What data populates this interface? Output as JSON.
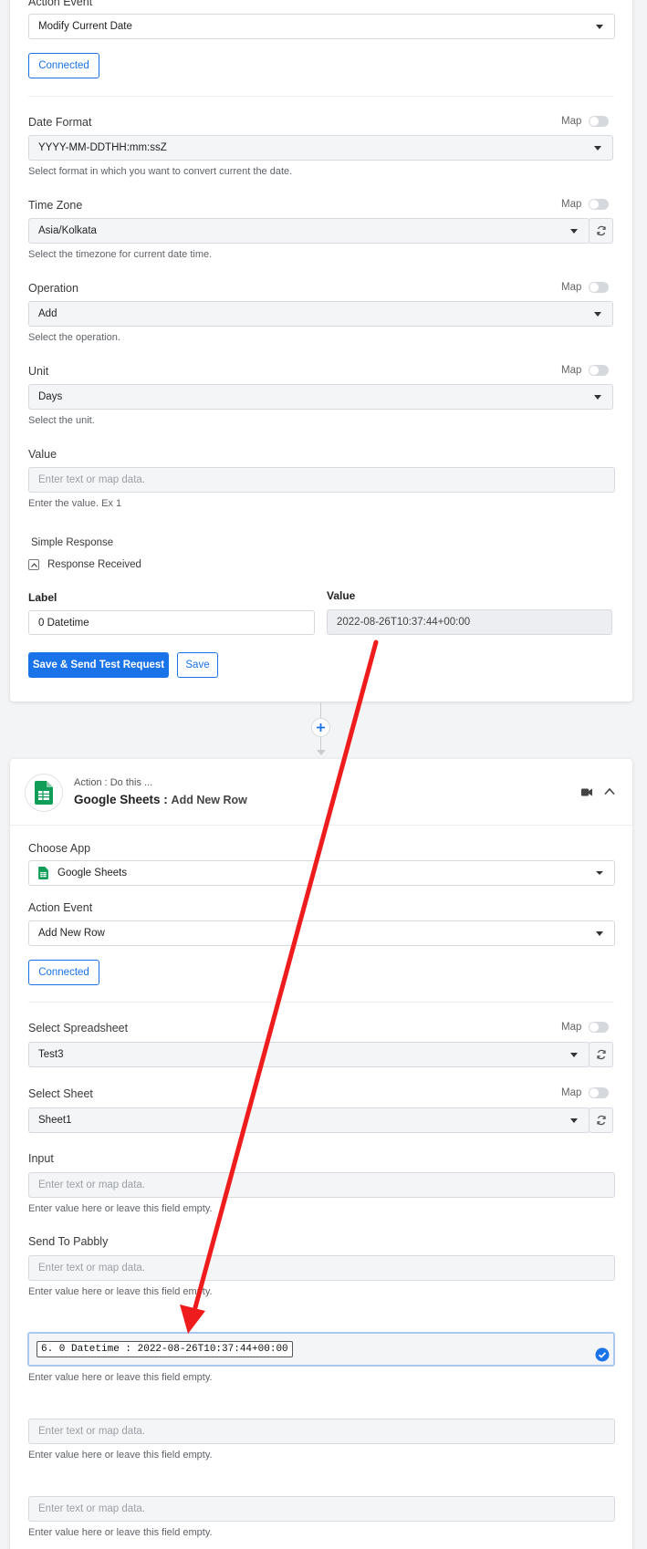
{
  "step1": {
    "action_event_label": "Action Event",
    "action_event_value": "Modify Current Date",
    "connected_label": "Connected",
    "map_label": "Map",
    "date_format": {
      "label": "Date Format",
      "value": "YYYY-MM-DDTHH:mm:ssZ",
      "help": "Select format in which you want to convert current the date."
    },
    "time_zone": {
      "label": "Time Zone",
      "value": "Asia/Kolkata",
      "help": "Select the timezone for current date time."
    },
    "operation": {
      "label": "Operation",
      "value": "Add",
      "help": "Select the operation."
    },
    "unit": {
      "label": "Unit",
      "value": "Days",
      "help": "Select the unit."
    },
    "value_field": {
      "label": "Value",
      "placeholder": "Enter text or map data.",
      "help": "Enter the value. Ex 1"
    },
    "simple_response_label": "Simple Response",
    "response_received_label": "Response Received",
    "response_table": {
      "label_header": "Label",
      "value_header": "Value",
      "row_label": "0 Datetime",
      "row_value": "2022-08-26T10:37:44+00:00"
    },
    "save_send_label": "Save & Send Test Request",
    "save_label": "Save"
  },
  "step2": {
    "header_small": "Action : Do this ...",
    "app_name": "Google Sheets :",
    "action_name": "Add New Row",
    "choose_app_label": "Choose App",
    "choose_app_value": "Google Sheets",
    "action_event_label": "Action Event",
    "action_event_value": "Add New Row",
    "connected_label": "Connected",
    "map_label": "Map",
    "spreadsheet": {
      "label": "Select Spreadsheet",
      "value": "Test3"
    },
    "sheet": {
      "label": "Select Sheet",
      "value": "Sheet1"
    },
    "input_field": {
      "label": "Input",
      "placeholder": "Enter text or map data.",
      "help": "Enter value here or leave this field empty."
    },
    "send_to_pabbly": {
      "label": "Send To Pabbly",
      "placeholder": "Enter text or map data.",
      "help": "Enter value here or leave this field empty."
    },
    "mapped_field": {
      "token": "6. 0 Datetime : 2022-08-26T10:37:44+00:00",
      "help": "Enter value here or leave this field empty."
    },
    "empty_field_1": {
      "placeholder": "Enter text or map data.",
      "help": "Enter value here or leave this field empty."
    },
    "empty_field_2": {
      "placeholder": "Enter text or map data.",
      "help": "Enter value here or leave this field empty."
    }
  },
  "colors": {
    "accent": "#1a73e8",
    "arrow": "#ee1c1c",
    "sheets_green": "#0f9d58"
  },
  "icons": [
    "chevron-down-icon",
    "refresh-icon",
    "plus-icon",
    "google-sheets-icon",
    "video-icon",
    "chevron-up-icon",
    "check-circle-icon",
    "collapse-icon"
  ]
}
